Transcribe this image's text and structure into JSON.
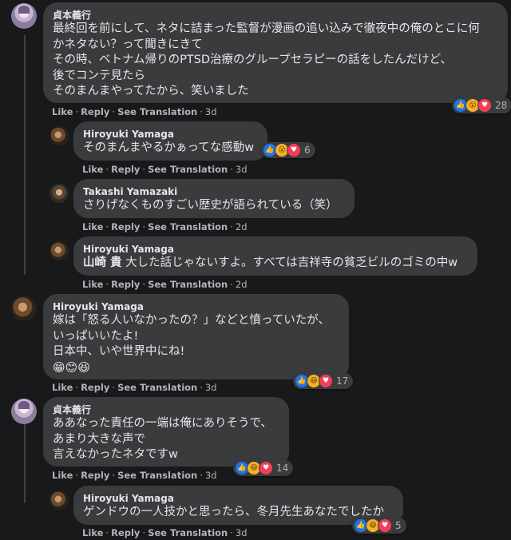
{
  "actions": {
    "like": "Like",
    "reply": "Reply",
    "translate": "See Translation"
  },
  "comments": [
    {
      "name": "貞本義行",
      "lines": [
        "最終回を前にして、ネタに詰まった監督が漫画の追い込みで徹夜中の俺のとこに何",
        "かネタない？って聞きにきて",
        "その時、ベトナム帰りのPTSD治療のグループセラピーの話をしたんだけど、",
        "後でコンテ見たら",
        "そのまんまやってたから、笑いました"
      ],
      "time": "3d",
      "reactions": 28
    },
    {
      "name": "Hiroyuki Yamaga",
      "lines": [
        "そのまんまやるかぁってな感動w"
      ],
      "time": "3d",
      "reactions": 6
    },
    {
      "name": "Takashi Yamazaki",
      "lines": [
        "さりげなくものすごい歴史が語られている（笑）"
      ],
      "time": "2d"
    },
    {
      "name": "Hiroyuki Yamaga",
      "tag": "山崎 貴",
      "lines": [
        " 大した話じゃないすよ。すべては吉祥寺の貧乏ビルのゴミの中w"
      ],
      "time": "2d"
    },
    {
      "name": "Hiroyuki Yamaga",
      "lines": [
        "嫁は「怒る人いなかったの？」などと憤っていたが、",
        "いっぱいいたよ!",
        "日本中、いや世界中にね!"
      ],
      "emoji": "😁😊😆",
      "time": "3d",
      "reactions": 17
    },
    {
      "name": "貞本義行",
      "lines": [
        "ああなった責任の一端は俺にありそうで、",
        "あまり大きな声で",
        "言えなかったネタですw"
      ],
      "time": "3d",
      "reactions": 14
    },
    {
      "name": "Hiroyuki Yamaga",
      "lines": [
        "ゲンドウの一人技かと思ったら、冬月先生あなたでしたか"
      ],
      "time": "3d",
      "reactions": 5
    }
  ],
  "colors": {
    "background": "#18191a",
    "bubble": "#3a3b3c",
    "like": "#1877f2",
    "love": "#f33e58",
    "haha": "#f7b125",
    "muted": "#b0b3b8"
  }
}
